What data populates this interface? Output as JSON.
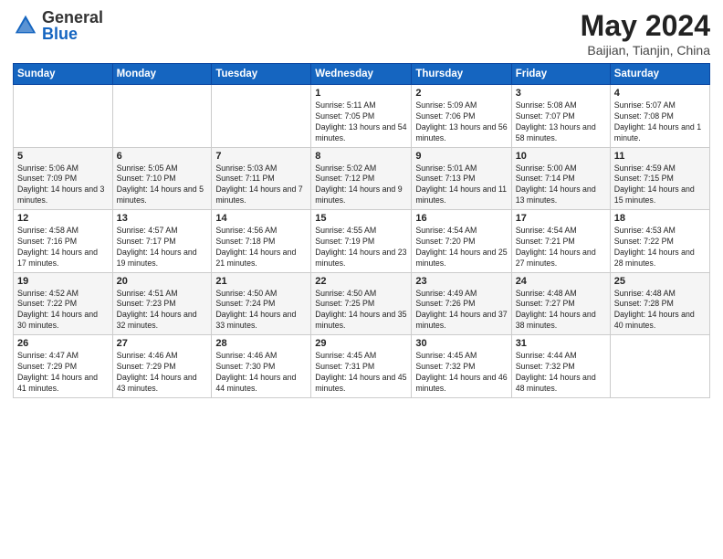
{
  "header": {
    "logo_general": "General",
    "logo_blue": "Blue",
    "title": "May 2024",
    "subtitle": "Baijian, Tianjin, China"
  },
  "weekdays": [
    "Sunday",
    "Monday",
    "Tuesday",
    "Wednesday",
    "Thursday",
    "Friday",
    "Saturday"
  ],
  "weeks": [
    [
      {
        "day": "",
        "info": ""
      },
      {
        "day": "",
        "info": ""
      },
      {
        "day": "",
        "info": ""
      },
      {
        "day": "1",
        "info": "Sunrise: 5:11 AM\nSunset: 7:05 PM\nDaylight: 13 hours and 54 minutes."
      },
      {
        "day": "2",
        "info": "Sunrise: 5:09 AM\nSunset: 7:06 PM\nDaylight: 13 hours and 56 minutes."
      },
      {
        "day": "3",
        "info": "Sunrise: 5:08 AM\nSunset: 7:07 PM\nDaylight: 13 hours and 58 minutes."
      },
      {
        "day": "4",
        "info": "Sunrise: 5:07 AM\nSunset: 7:08 PM\nDaylight: 14 hours and 1 minute."
      }
    ],
    [
      {
        "day": "5",
        "info": "Sunrise: 5:06 AM\nSunset: 7:09 PM\nDaylight: 14 hours and 3 minutes."
      },
      {
        "day": "6",
        "info": "Sunrise: 5:05 AM\nSunset: 7:10 PM\nDaylight: 14 hours and 5 minutes."
      },
      {
        "day": "7",
        "info": "Sunrise: 5:03 AM\nSunset: 7:11 PM\nDaylight: 14 hours and 7 minutes."
      },
      {
        "day": "8",
        "info": "Sunrise: 5:02 AM\nSunset: 7:12 PM\nDaylight: 14 hours and 9 minutes."
      },
      {
        "day": "9",
        "info": "Sunrise: 5:01 AM\nSunset: 7:13 PM\nDaylight: 14 hours and 11 minutes."
      },
      {
        "day": "10",
        "info": "Sunrise: 5:00 AM\nSunset: 7:14 PM\nDaylight: 14 hours and 13 minutes."
      },
      {
        "day": "11",
        "info": "Sunrise: 4:59 AM\nSunset: 7:15 PM\nDaylight: 14 hours and 15 minutes."
      }
    ],
    [
      {
        "day": "12",
        "info": "Sunrise: 4:58 AM\nSunset: 7:16 PM\nDaylight: 14 hours and 17 minutes."
      },
      {
        "day": "13",
        "info": "Sunrise: 4:57 AM\nSunset: 7:17 PM\nDaylight: 14 hours and 19 minutes."
      },
      {
        "day": "14",
        "info": "Sunrise: 4:56 AM\nSunset: 7:18 PM\nDaylight: 14 hours and 21 minutes."
      },
      {
        "day": "15",
        "info": "Sunrise: 4:55 AM\nSunset: 7:19 PM\nDaylight: 14 hours and 23 minutes."
      },
      {
        "day": "16",
        "info": "Sunrise: 4:54 AM\nSunset: 7:20 PM\nDaylight: 14 hours and 25 minutes."
      },
      {
        "day": "17",
        "info": "Sunrise: 4:54 AM\nSunset: 7:21 PM\nDaylight: 14 hours and 27 minutes."
      },
      {
        "day": "18",
        "info": "Sunrise: 4:53 AM\nSunset: 7:22 PM\nDaylight: 14 hours and 28 minutes."
      }
    ],
    [
      {
        "day": "19",
        "info": "Sunrise: 4:52 AM\nSunset: 7:22 PM\nDaylight: 14 hours and 30 minutes."
      },
      {
        "day": "20",
        "info": "Sunrise: 4:51 AM\nSunset: 7:23 PM\nDaylight: 14 hours and 32 minutes."
      },
      {
        "day": "21",
        "info": "Sunrise: 4:50 AM\nSunset: 7:24 PM\nDaylight: 14 hours and 33 minutes."
      },
      {
        "day": "22",
        "info": "Sunrise: 4:50 AM\nSunset: 7:25 PM\nDaylight: 14 hours and 35 minutes."
      },
      {
        "day": "23",
        "info": "Sunrise: 4:49 AM\nSunset: 7:26 PM\nDaylight: 14 hours and 37 minutes."
      },
      {
        "day": "24",
        "info": "Sunrise: 4:48 AM\nSunset: 7:27 PM\nDaylight: 14 hours and 38 minutes."
      },
      {
        "day": "25",
        "info": "Sunrise: 4:48 AM\nSunset: 7:28 PM\nDaylight: 14 hours and 40 minutes."
      }
    ],
    [
      {
        "day": "26",
        "info": "Sunrise: 4:47 AM\nSunset: 7:29 PM\nDaylight: 14 hours and 41 minutes."
      },
      {
        "day": "27",
        "info": "Sunrise: 4:46 AM\nSunset: 7:29 PM\nDaylight: 14 hours and 43 minutes."
      },
      {
        "day": "28",
        "info": "Sunrise: 4:46 AM\nSunset: 7:30 PM\nDaylight: 14 hours and 44 minutes."
      },
      {
        "day": "29",
        "info": "Sunrise: 4:45 AM\nSunset: 7:31 PM\nDaylight: 14 hours and 45 minutes."
      },
      {
        "day": "30",
        "info": "Sunrise: 4:45 AM\nSunset: 7:32 PM\nDaylight: 14 hours and 46 minutes."
      },
      {
        "day": "31",
        "info": "Sunrise: 4:44 AM\nSunset: 7:32 PM\nDaylight: 14 hours and 48 minutes."
      },
      {
        "day": "",
        "info": ""
      }
    ]
  ]
}
